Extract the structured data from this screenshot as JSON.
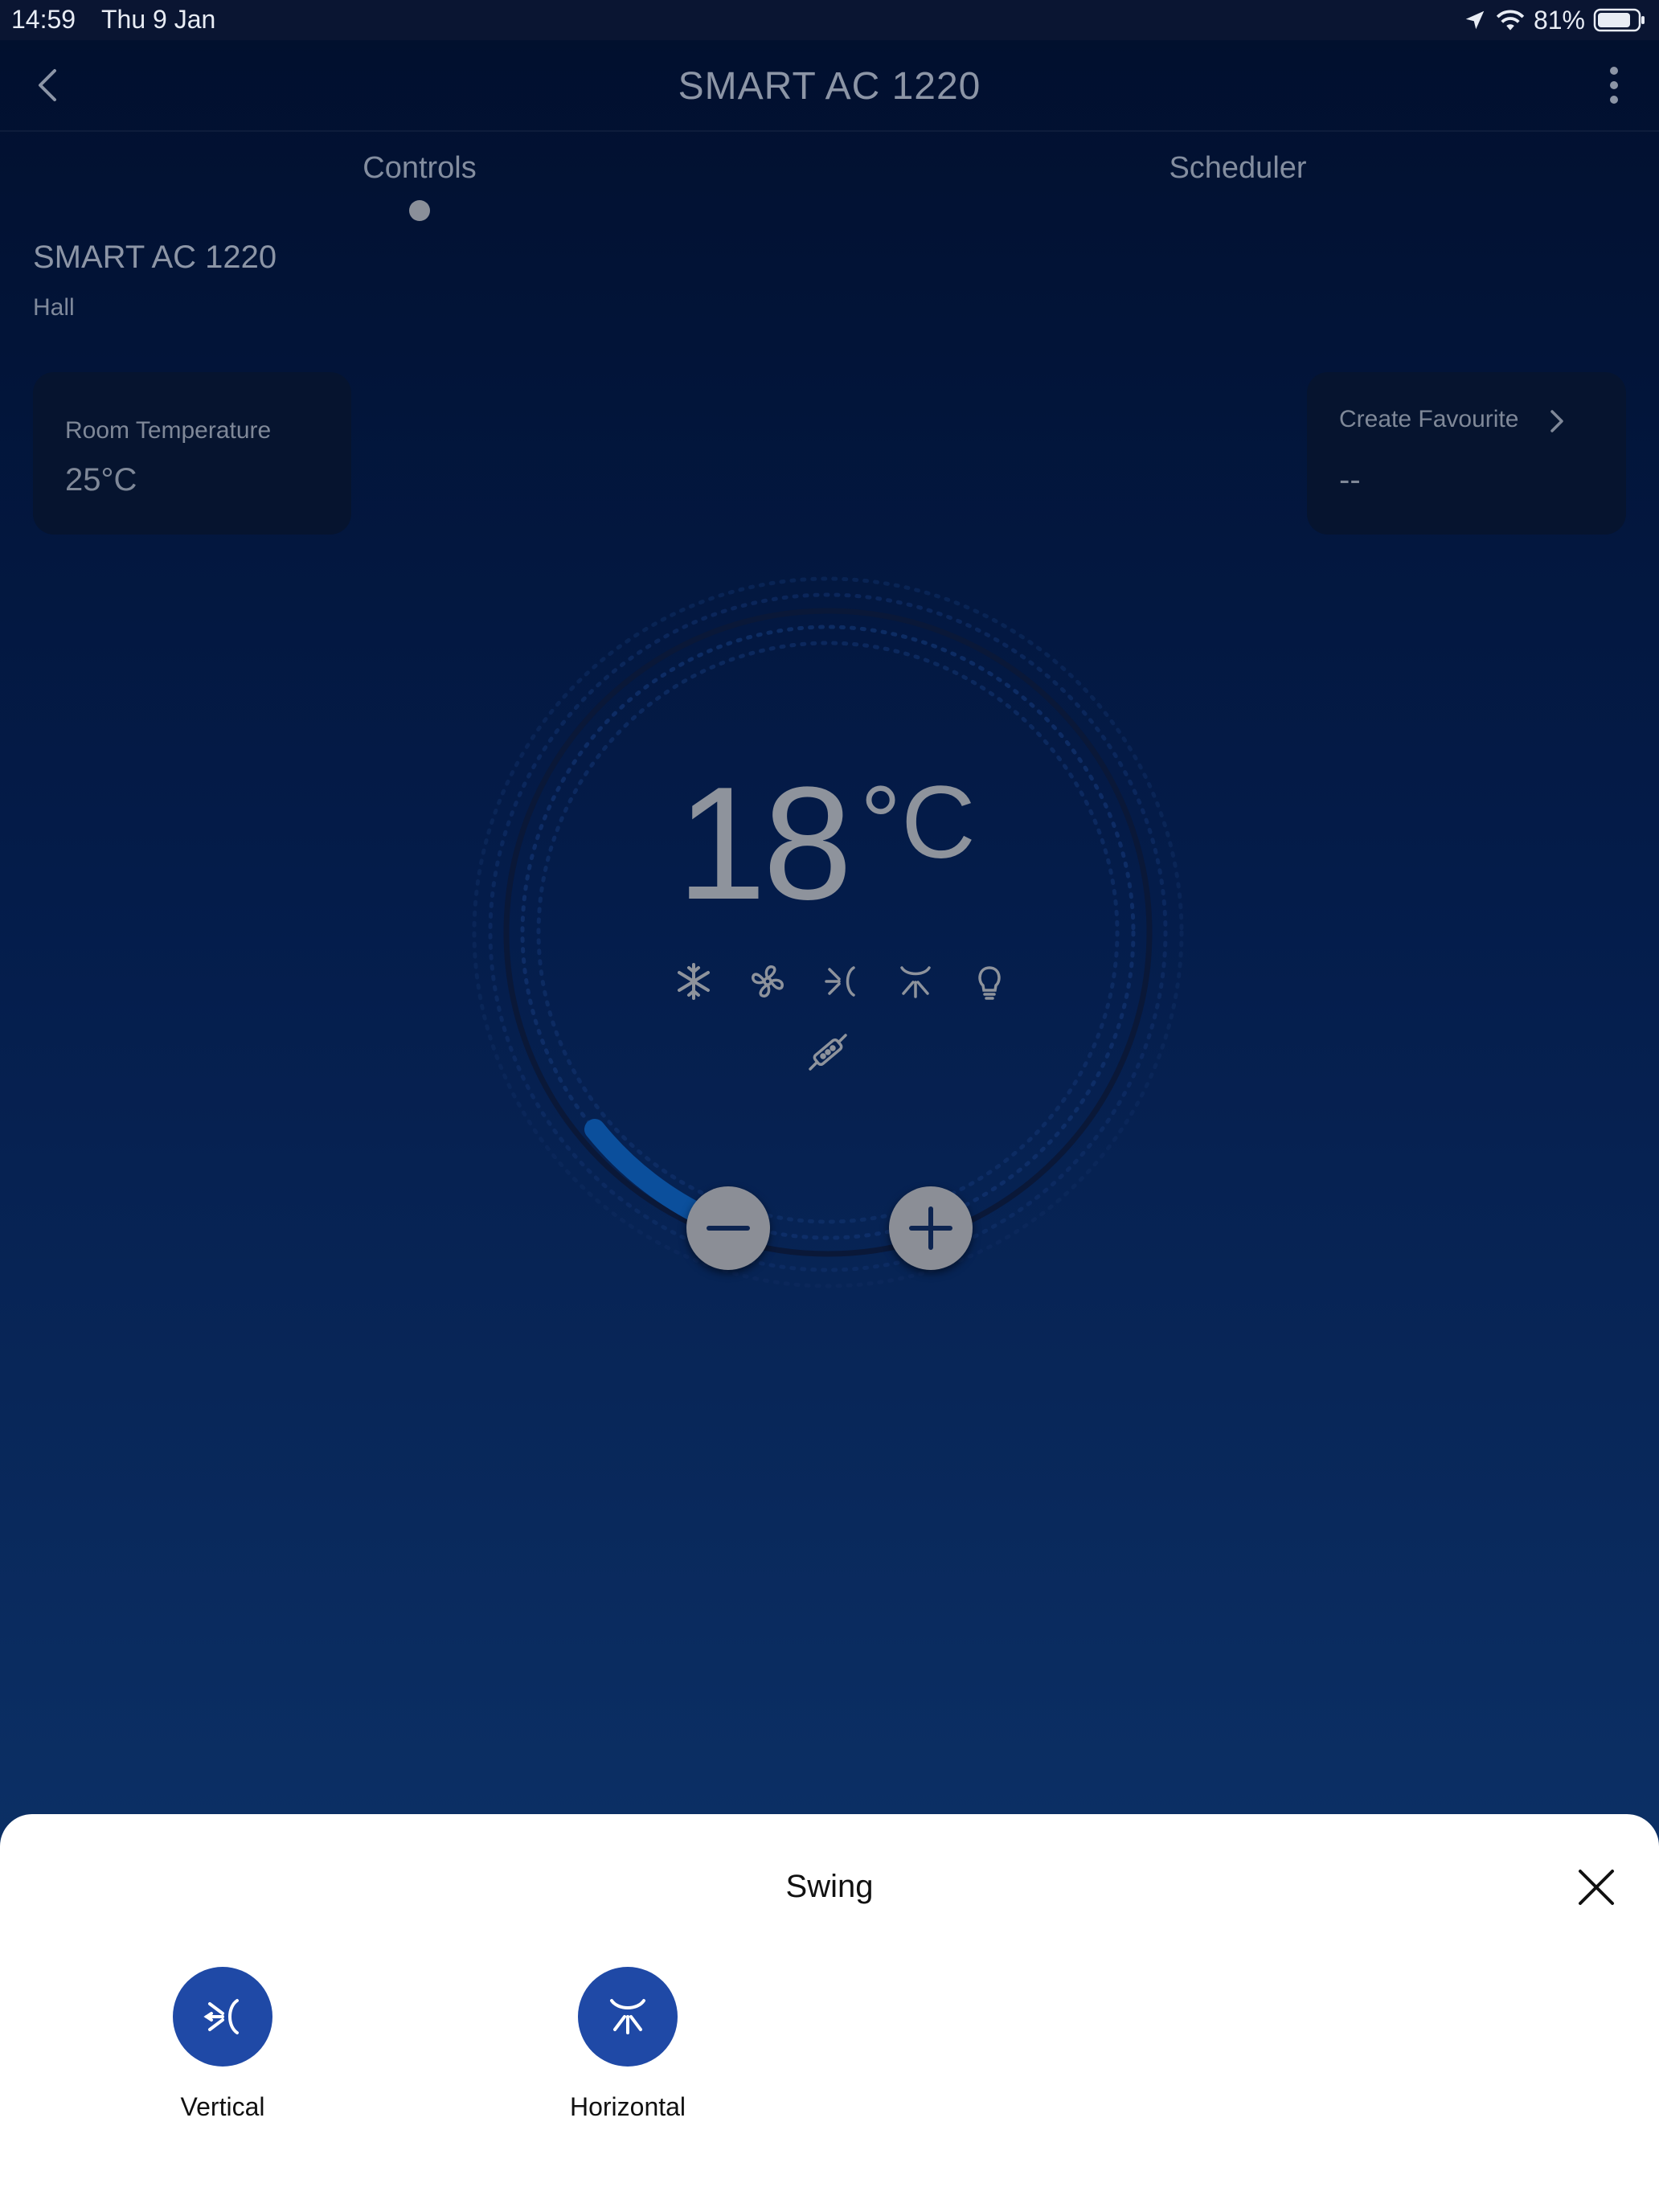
{
  "status_bar": {
    "time": "14:59",
    "date": "Thu 9 Jan",
    "battery": "81%",
    "icons": [
      "location-icon",
      "wifi-icon",
      "battery-icon"
    ]
  },
  "nav": {
    "title": "SMART AC 1220",
    "back_icon": "chevron-left-icon",
    "more_icon": "more-vertical-icon"
  },
  "tabs": [
    {
      "label": "Controls",
      "active": true
    },
    {
      "label": "Scheduler",
      "active": false
    }
  ],
  "device": {
    "name": "SMART AC 1220",
    "room": "Hall"
  },
  "room_temperature": {
    "label": "Room Temperature",
    "value": "25°C"
  },
  "favourite": {
    "label": "Create Favourite",
    "value": "--"
  },
  "thermostat": {
    "set_temp": "18",
    "unit": "°C",
    "mode_icons": [
      "snowflake-icon",
      "fan-icon",
      "vertical-swing-icon",
      "horizontal-swing-icon",
      "light-bulb-icon",
      "filter-icon"
    ],
    "decrease_icon": "minus-icon",
    "increase_icon": "plus-icon"
  },
  "swing_sheet": {
    "title": "Swing",
    "close_icon": "close-icon",
    "options": [
      {
        "label": "Vertical",
        "icon": "vertical-swing-icon"
      },
      {
        "label": "Horizontal",
        "icon": "horizontal-swing-icon"
      }
    ]
  },
  "colors": {
    "background_top": "#010f2d",
    "background_bottom": "#0e3770",
    "accent_blue": "#1f49a6",
    "dial_arc": "#0b4f9c"
  }
}
